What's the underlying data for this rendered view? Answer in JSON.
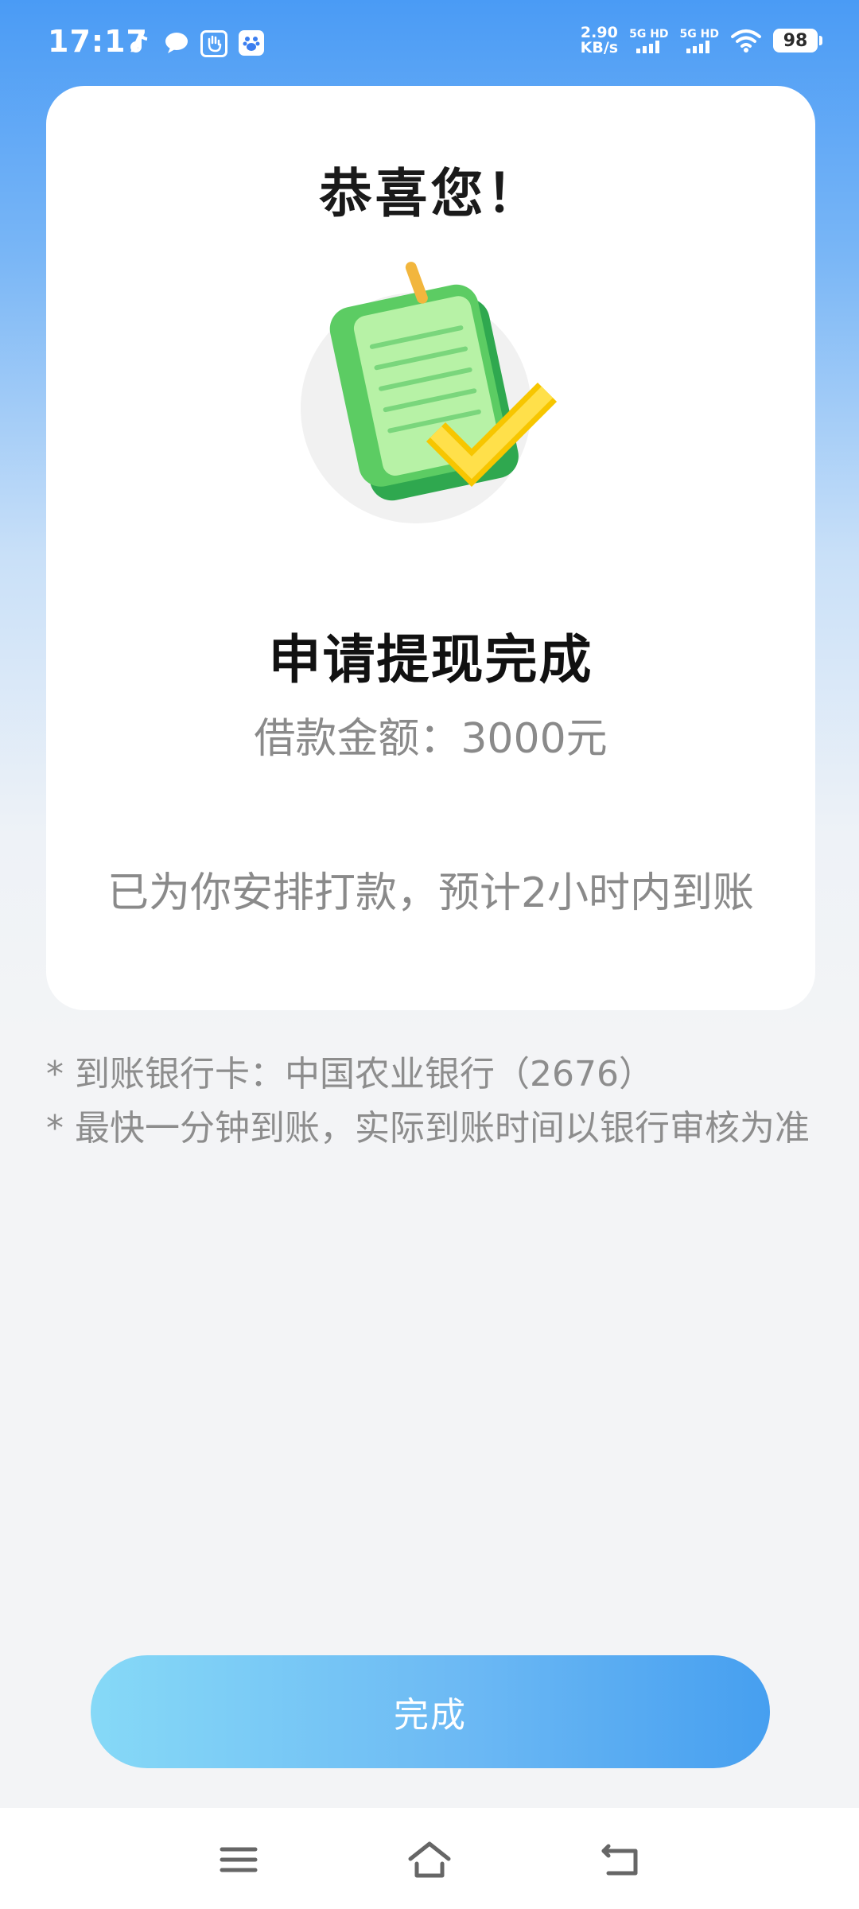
{
  "status_bar": {
    "time": "17:17",
    "net_speed_value": "2.90",
    "net_speed_unit": "KB/s",
    "signal1_label": "5G HD",
    "signal2_label": "5G HD",
    "battery": "98",
    "app_icons": [
      "tiktok-icon",
      "message-icon",
      "hand-app-icon",
      "baidu-icon"
    ]
  },
  "card": {
    "congrats": "恭喜您！",
    "illustration": "document-check-icon",
    "title": "申请提现完成",
    "amount_label": "借款金额：",
    "amount_value": "3000元",
    "arrange_text": "已为你安排打款，预计2小时内到账"
  },
  "notes": [
    "* 到账银行卡：中国农业银行（2676）",
    "* 最快一分钟到账，实际到账时间以银行审核为准"
  ],
  "done_button": "完成",
  "nav_bar": {
    "menu": "menu-icon",
    "home": "home-icon",
    "back": "back-icon"
  },
  "colors": {
    "accent_start": "#86d9f7",
    "accent_end": "#469ff0",
    "header_blue": "#4a9bf5"
  }
}
